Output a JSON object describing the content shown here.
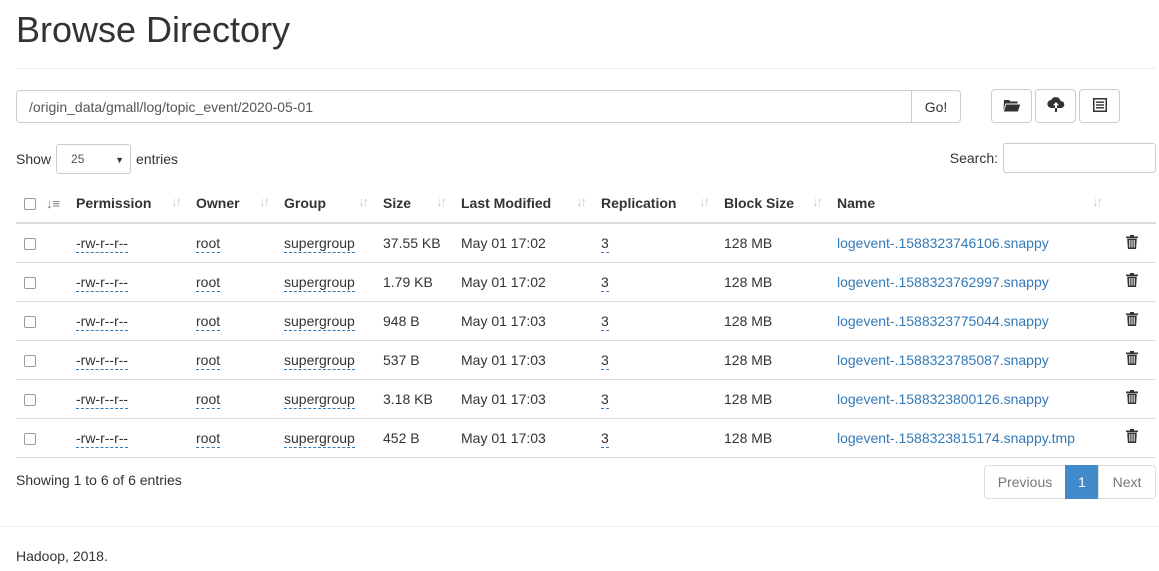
{
  "page": {
    "title": "Browse Directory"
  },
  "path_bar": {
    "value": "/origin_data/gmall/log/topic_event/2020-05-01",
    "go_label": "Go!"
  },
  "toolbar": {
    "icons": [
      "folder-open-icon",
      "upload-cloud-icon",
      "list-icon"
    ]
  },
  "table_controls": {
    "show_label": "Show",
    "page_length": "25",
    "entries_label": "entries",
    "search_label": "Search:",
    "search_value": ""
  },
  "columns": [
    "Permission",
    "Owner",
    "Group",
    "Size",
    "Last Modified",
    "Replication",
    "Block Size",
    "Name"
  ],
  "rows": [
    {
      "permission": "-rw-r--r--",
      "owner": "root",
      "group": "supergroup",
      "size": "37.55 KB",
      "modified": "May 01 17:02",
      "replication": "3",
      "block_size": "128 MB",
      "name": "logevent-.1588323746106.snappy"
    },
    {
      "permission": "-rw-r--r--",
      "owner": "root",
      "group": "supergroup",
      "size": "1.79 KB",
      "modified": "May 01 17:02",
      "replication": "3",
      "block_size": "128 MB",
      "name": "logevent-.1588323762997.snappy"
    },
    {
      "permission": "-rw-r--r--",
      "owner": "root",
      "group": "supergroup",
      "size": "948 B",
      "modified": "May 01 17:03",
      "replication": "3",
      "block_size": "128 MB",
      "name": "logevent-.1588323775044.snappy"
    },
    {
      "permission": "-rw-r--r--",
      "owner": "root",
      "group": "supergroup",
      "size": "537 B",
      "modified": "May 01 17:03",
      "replication": "3",
      "block_size": "128 MB",
      "name": "logevent-.1588323785087.snappy"
    },
    {
      "permission": "-rw-r--r--",
      "owner": "root",
      "group": "supergroup",
      "size": "3.18 KB",
      "modified": "May 01 17:03",
      "replication": "3",
      "block_size": "128 MB",
      "name": "logevent-.1588323800126.snappy"
    },
    {
      "permission": "-rw-r--r--",
      "owner": "root",
      "group": "supergroup",
      "size": "452 B",
      "modified": "May 01 17:03",
      "replication": "3",
      "block_size": "128 MB",
      "name": "logevent-.1588323815174.snappy.tmp"
    }
  ],
  "pagination": {
    "info": "Showing 1 to 6 of 6 entries",
    "previous": "Previous",
    "current": "1",
    "next": "Next"
  },
  "footer": {
    "text": "Hadoop, 2018."
  },
  "colors": {
    "link": "#337ab7",
    "active_page": "#428bca",
    "border": "#dddddd"
  }
}
